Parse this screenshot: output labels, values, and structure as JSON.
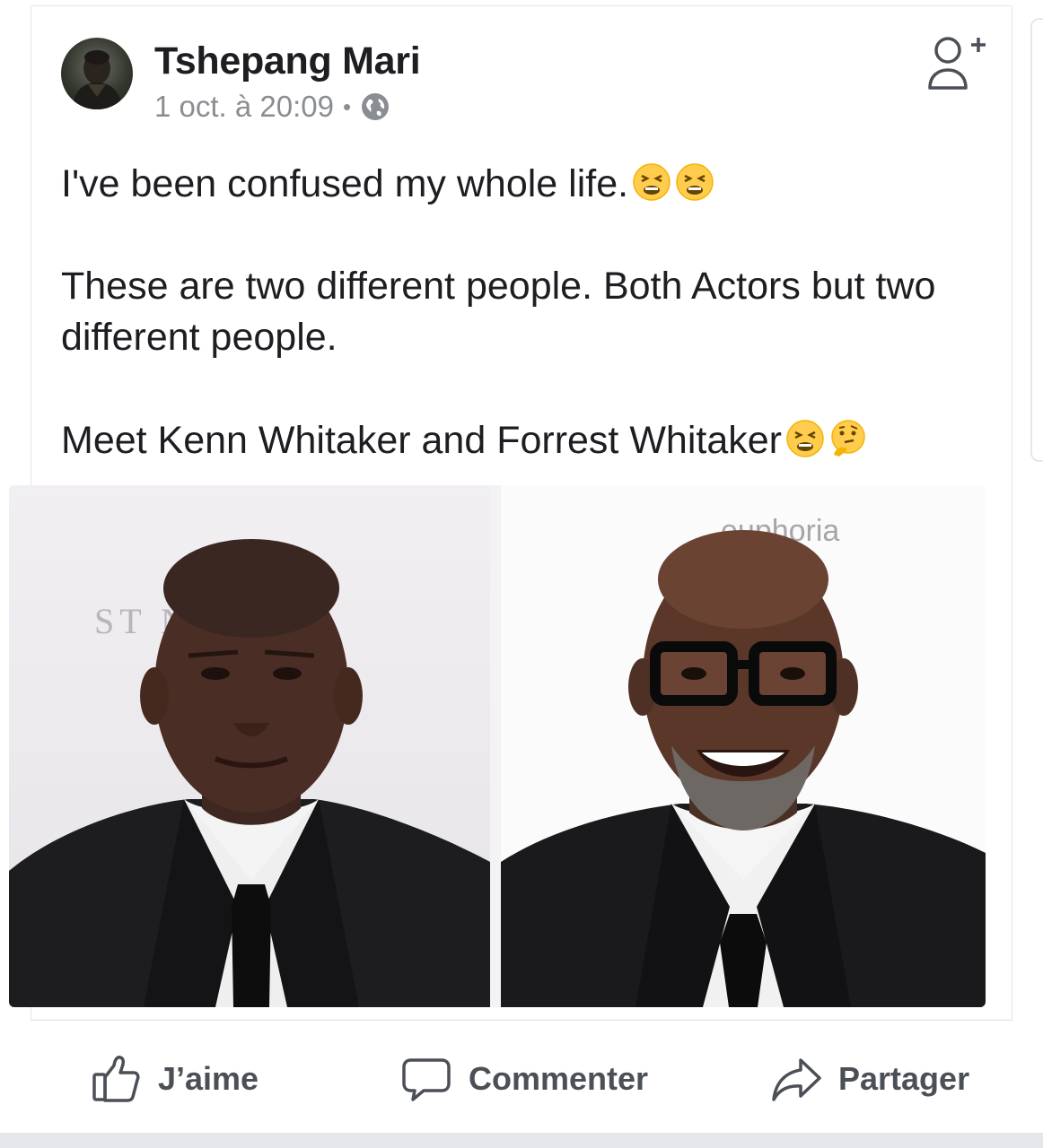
{
  "post": {
    "author_name": "Tshepang Mari",
    "timestamp": "1 oct. à 20:09",
    "separator": "•",
    "privacy_icon": "globe-icon",
    "text_line1": "I've been confused my whole life.",
    "text_line2": "These are two different people. Both Actors but two different people.",
    "text_line3": "Meet Kenn Whitaker and Forrest Whitaker",
    "emojis_line1": [
      "tired-face-emoji",
      "tired-face-emoji"
    ],
    "emojis_line3": [
      "tired-face-emoji",
      "thinking-face-emoji"
    ]
  },
  "photo": {
    "left_backdrop_text": "ST ND",
    "right_backdrop_text": "euphoria"
  },
  "actions": {
    "like_label": "J’aime",
    "comment_label": "Commenter",
    "share_label": "Partager"
  },
  "colors": {
    "text": "#1c1e21",
    "meta": "#8a8d91",
    "action": "#4b4f56",
    "divider": "#dadde1"
  }
}
